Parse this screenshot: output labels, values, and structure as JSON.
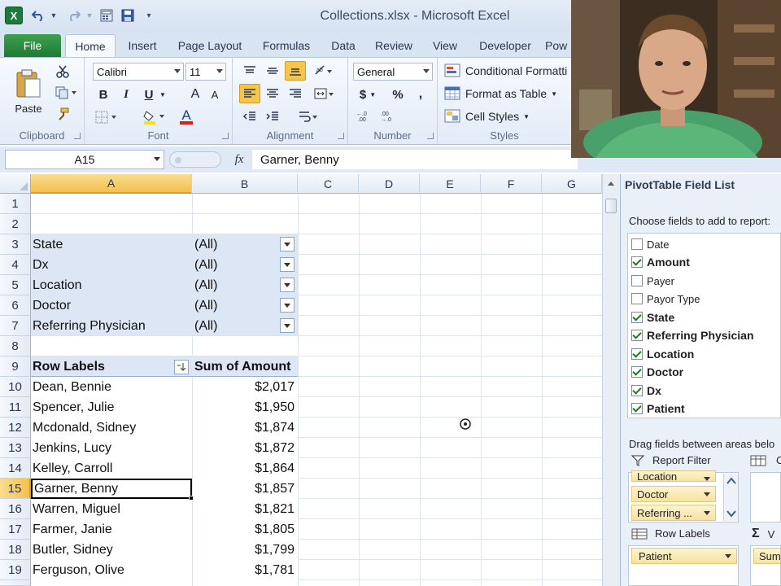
{
  "window": {
    "title": "Collections.xlsx - Microsoft Excel",
    "app_icon": "X"
  },
  "ribbon": {
    "tabs": [
      "File",
      "Home",
      "Insert",
      "Page Layout",
      "Formulas",
      "Data",
      "Review",
      "View",
      "Developer",
      "Pow"
    ],
    "active_tab": "Home",
    "clipboard": {
      "paste": "Paste",
      "label": "Clipboard"
    },
    "font": {
      "name": "Calibri",
      "size": "11",
      "bold": "B",
      "italic": "I",
      "underline": "U",
      "grow": "A",
      "shrink": "A",
      "font_color": "A",
      "label": "Font"
    },
    "alignment": {
      "label": "Alignment"
    },
    "number": {
      "format": "General",
      "currency": "$",
      "percent": "%",
      "comma": ",",
      "label": "Number"
    },
    "styles": {
      "conditional": "Conditional Formatti",
      "format_table": "Format as Table",
      "cell_styles": "Cell Styles",
      "label": "Styles"
    }
  },
  "formula_bar": {
    "name_box": "A15",
    "fx": "fx",
    "value": "Garner, Benny"
  },
  "grid": {
    "columns": [
      "A",
      "B",
      "C",
      "D",
      "E",
      "F",
      "G"
    ],
    "rows": [
      "1",
      "2",
      "3",
      "4",
      "5",
      "6",
      "7",
      "8",
      "9",
      "10",
      "11",
      "12",
      "13",
      "14",
      "15",
      "16",
      "17",
      "18",
      "19"
    ],
    "filters": [
      {
        "label": "State",
        "value": "(All)"
      },
      {
        "label": "Dx",
        "value": "(All)"
      },
      {
        "label": "Location",
        "value": "(All)"
      },
      {
        "label": "Doctor",
        "value": "(All)"
      },
      {
        "label": "Referring Physician",
        "value": "(All)"
      }
    ],
    "header": {
      "row_labels": "Row Labels",
      "sum": "Sum of Amount"
    },
    "data": [
      {
        "name": "Dean, Bennie",
        "amount": "$2,017"
      },
      {
        "name": "Spencer, Julie",
        "amount": "$1,950"
      },
      {
        "name": "Mcdonald, Sidney",
        "amount": "$1,874"
      },
      {
        "name": "Jenkins, Lucy",
        "amount": "$1,872"
      },
      {
        "name": "Kelley, Carroll",
        "amount": "$1,864"
      },
      {
        "name": "Garner, Benny",
        "amount": "$1,857"
      },
      {
        "name": "Warren, Miguel",
        "amount": "$1,821"
      },
      {
        "name": "Farmer, Janie",
        "amount": "$1,805"
      },
      {
        "name": "Butler, Sidney",
        "amount": "$1,799"
      },
      {
        "name": "Ferguson, Olive",
        "amount": "$1,781"
      }
    ],
    "selected_cell": "A15"
  },
  "pivot_pane": {
    "title": "PivotTable Field List",
    "choose": "Choose fields to add to report:",
    "fields": [
      {
        "name": "Date",
        "checked": false
      },
      {
        "name": "Amount",
        "checked": true
      },
      {
        "name": "Payer",
        "checked": false
      },
      {
        "name": "Payor Type",
        "checked": false
      },
      {
        "name": "State",
        "checked": true
      },
      {
        "name": "Referring Physician",
        "checked": true
      },
      {
        "name": "Location",
        "checked": true
      },
      {
        "name": "Doctor",
        "checked": true
      },
      {
        "name": "Dx",
        "checked": true
      },
      {
        "name": "Patient",
        "checked": true
      }
    ],
    "drag_text": "Drag fields between areas belo",
    "report_filter": "Report Filter",
    "filter_chips": [
      "Location",
      "Doctor",
      "Referring ..."
    ],
    "row_labels": "Row Labels",
    "row_chip": "Patient",
    "values_chip": "Sum",
    "col_hint": "C",
    "values_hint": "V"
  },
  "colors": {
    "selected_header": "#f6c64a",
    "pivot_filter_bg": "#dce6f4",
    "pivot_header_bg": "#dce6f4",
    "file_tab": "#2f8f41",
    "chip": "#f8e6a8"
  }
}
